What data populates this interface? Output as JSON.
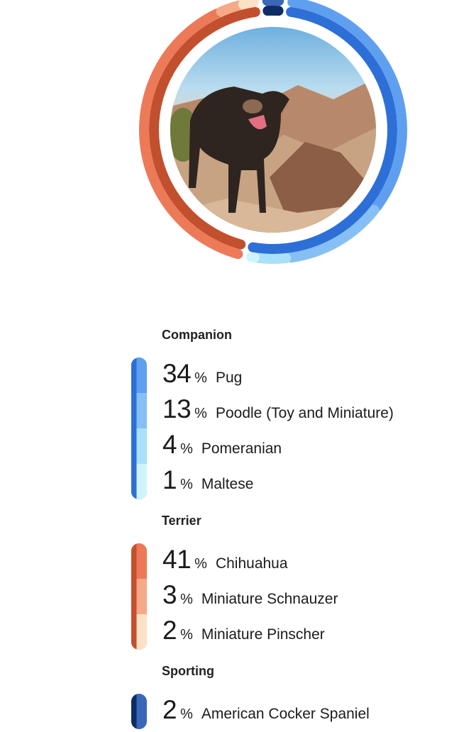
{
  "chart_data": {
    "type": "donut",
    "title": "",
    "groups": [
      {
        "name": "Companion",
        "side": "right",
        "bar_color": "#2d6fd6",
        "breeds": [
          {
            "name": "Pug",
            "percent": 34,
            "color": "#5f9ff0"
          },
          {
            "name": "Poodle (Toy and Miniature)",
            "percent": 13,
            "color": "#86bff5"
          },
          {
            "name": "Pomeranian",
            "percent": 4,
            "color": "#a9e1fa"
          },
          {
            "name": "Maltese",
            "percent": 1,
            "color": "#cff4fd"
          }
        ]
      },
      {
        "name": "Terrier",
        "side": "left",
        "bar_color": "#c24f2e",
        "breeds": [
          {
            "name": "Chihuahua",
            "percent": 41,
            "color": "#ec7a58"
          },
          {
            "name": "Miniature Schnauzer",
            "percent": 3,
            "color": "#f6a987"
          },
          {
            "name": "Miniature Pinscher",
            "percent": 2,
            "color": "#fde1c6"
          }
        ]
      },
      {
        "name": "Sporting",
        "side": "top",
        "bar_color": "#0e2d66",
        "breeds": [
          {
            "name": "American Cocker Spaniel",
            "percent": 2,
            "color": "#3a67b8"
          }
        ]
      }
    ]
  },
  "percent_sign": "%",
  "photo": {
    "subject": "dog-photo"
  }
}
